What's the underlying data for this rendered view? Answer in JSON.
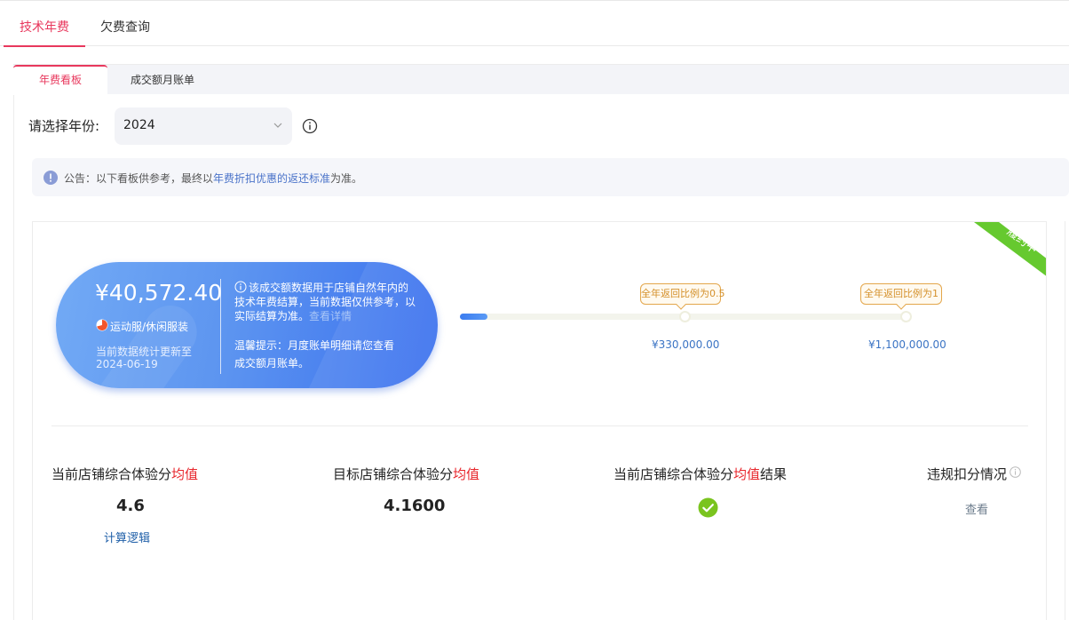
{
  "top_tabs": [
    {
      "label": "技术年费",
      "active": true
    },
    {
      "label": "欠费查询",
      "active": false
    }
  ],
  "sub_tabs": [
    {
      "label": "年费看板",
      "active": true
    },
    {
      "label": "成交额月账单",
      "active": false
    }
  ],
  "year_filter": {
    "label": "请选择年份:",
    "selected": "2024"
  },
  "notice": {
    "prefix": "公告：以下看板供参考，最终以",
    "link": "年费折扣优惠的返还标准",
    "suffix": "为准。"
  },
  "status_ribbon": "履约中",
  "summary": {
    "amount": "¥40,572.40",
    "category": "运动服/休闲服装",
    "update_line1": "当前数据统计更新至",
    "update_line2": "2024-06-19",
    "description": "该成交额数据用于店铺自然年内的技术年费结算，当前数据仅供参考，以实际结算为准。",
    "description_link": "查看详情",
    "tip": "温馨提示：月度账单明细请您查看成交额月账单。"
  },
  "progress": {
    "fraction": 0.037,
    "milestones": [
      {
        "badge": "全年返回比例为0.5",
        "threshold": "¥330,000.00"
      },
      {
        "badge": "全年返回比例为1",
        "threshold": "¥1,100,000.00"
      }
    ]
  },
  "stats": {
    "current_score": {
      "title_prefix": "当前店铺综合体验分",
      "title_accent": "均值",
      "title_suffix": "",
      "value": "4.6",
      "link": "计算逻辑"
    },
    "target_score": {
      "title_prefix": "目标店铺综合体验分",
      "title_accent": "均值",
      "title_suffix": "",
      "value": "4.1600"
    },
    "result": {
      "title_prefix": "当前店铺综合体验分",
      "title_accent": "均值",
      "title_suffix": "结果",
      "icon": "check-circle-icon"
    },
    "violation": {
      "title": "违规扣分情况",
      "link": "查看"
    }
  },
  "colors": {
    "accent": "#e8385d",
    "link": "#3b74c4",
    "pill_gradient_start": "#72aaf5",
    "pill_gradient_end": "#3a70ee",
    "success": "#7ac41f",
    "ribbon": "#66c92f"
  }
}
